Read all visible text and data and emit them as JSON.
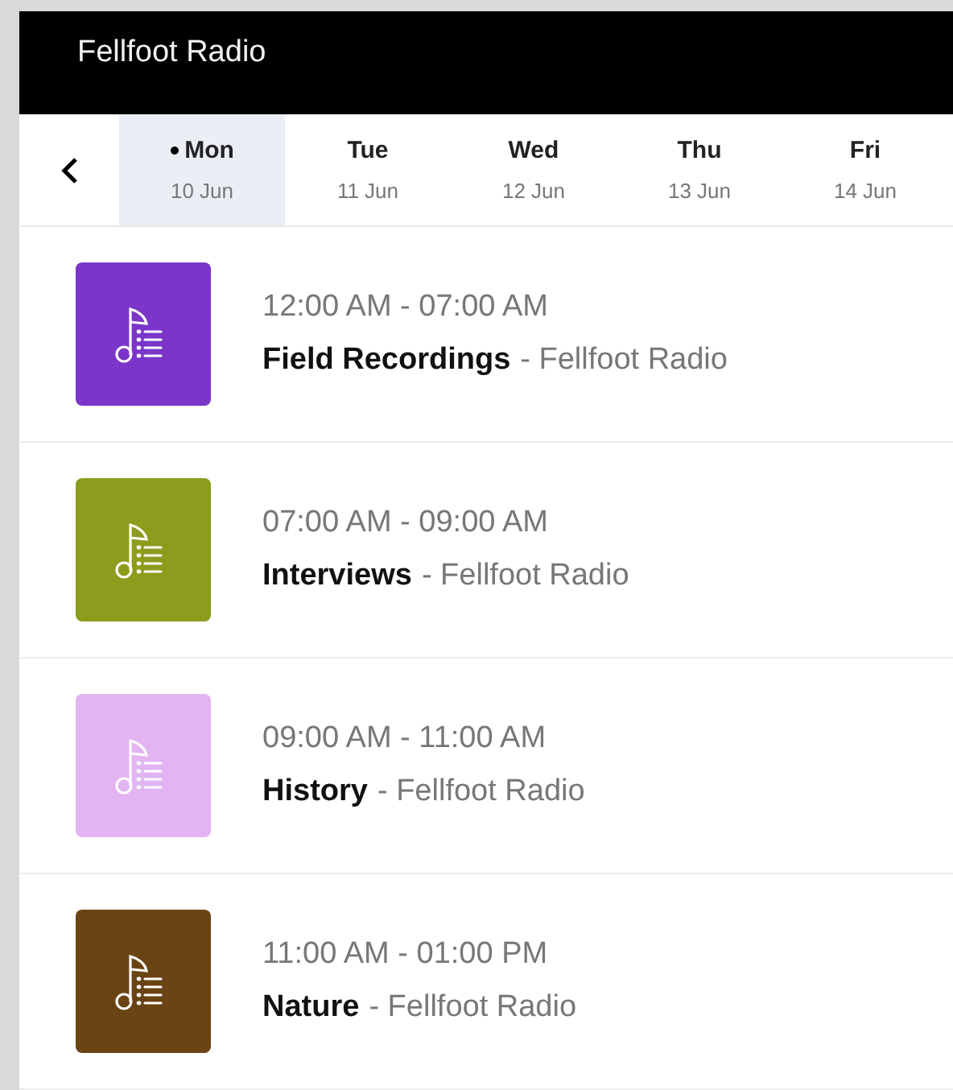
{
  "header": {
    "title": "Fellfoot Radio"
  },
  "days": [
    {
      "day": "Mon",
      "date": "10 Jun",
      "selected": true,
      "today": true
    },
    {
      "day": "Tue",
      "date": "11 Jun",
      "selected": false,
      "today": false
    },
    {
      "day": "Wed",
      "date": "12 Jun",
      "selected": false,
      "today": false
    },
    {
      "day": "Thu",
      "date": "13 Jun",
      "selected": false,
      "today": false
    },
    {
      "day": "Fri",
      "date": "14 Jun",
      "selected": false,
      "today": false
    }
  ],
  "programmes": [
    {
      "time": "12:00 AM - 07:00 AM",
      "title": "Field Recordings",
      "station": "- Fellfoot Radio",
      "color": "#7b35c8"
    },
    {
      "time": "07:00 AM - 09:00 AM",
      "title": "Interviews",
      "station": "- Fellfoot Radio",
      "color": "#8c9c1c"
    },
    {
      "time": "09:00 AM - 11:00 AM",
      "title": "History",
      "station": "- Fellfoot Radio",
      "color": "#e2b4f2"
    },
    {
      "time": "11:00 AM - 01:00 PM",
      "title": "Nature",
      "station": "- Fellfoot Radio",
      "color": "#6b4414"
    }
  ]
}
